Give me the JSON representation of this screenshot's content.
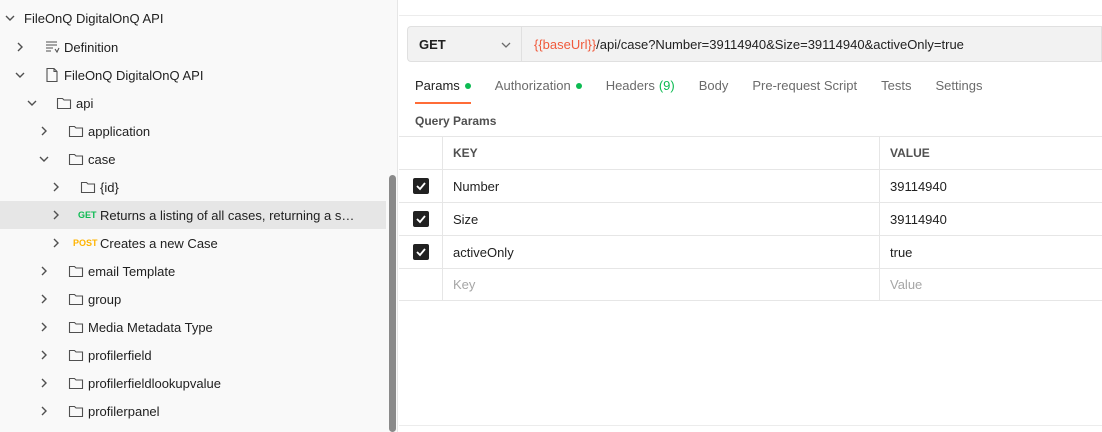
{
  "sidebar": {
    "items": [
      {
        "label": "FileOnQ DigitalOnQ API",
        "type": "collection",
        "expanded": true
      },
      {
        "label": "Definition",
        "type": "definition",
        "expanded": false
      },
      {
        "label": "FileOnQ DigitalOnQ API",
        "type": "document",
        "expanded": true
      },
      {
        "label": "api",
        "type": "folder",
        "expanded": true
      },
      {
        "label": "application",
        "type": "folder",
        "expanded": false
      },
      {
        "label": "case",
        "type": "folder",
        "expanded": true
      },
      {
        "label": "{id}",
        "type": "folder",
        "expanded": false
      },
      {
        "label": "Returns a listing of all cases, returning a sp...",
        "type": "request",
        "method": "GET",
        "selected": true
      },
      {
        "label": "Creates a new Case",
        "type": "request",
        "method": "POST"
      },
      {
        "label": "email Template",
        "type": "folder",
        "expanded": false
      },
      {
        "label": "group",
        "type": "folder",
        "expanded": false
      },
      {
        "label": "Media Metadata Type",
        "type": "folder",
        "expanded": false
      },
      {
        "label": "profilerfield",
        "type": "folder",
        "expanded": false
      },
      {
        "label": "profilerfieldlookupvalue",
        "type": "folder",
        "expanded": false
      },
      {
        "label": "profilerpanel",
        "type": "folder",
        "expanded": false
      }
    ]
  },
  "request": {
    "method": "GET",
    "url_variable": "{{baseUrl}}",
    "url_path": "/api/case?Number=39114940&Size=39114940&activeOnly=true"
  },
  "tabs": [
    {
      "label": "Params",
      "active": true,
      "dot": true
    },
    {
      "label": "Authorization",
      "dot": true
    },
    {
      "label": "Headers",
      "count": "(9)"
    },
    {
      "label": "Body"
    },
    {
      "label": "Pre-request Script"
    },
    {
      "label": "Tests"
    },
    {
      "label": "Settings"
    }
  ],
  "query_params": {
    "title": "Query Params",
    "header_key": "KEY",
    "header_value": "VALUE",
    "rows": [
      {
        "key": "Number",
        "value": "39114940",
        "checked": true
      },
      {
        "key": "Size",
        "value": "39114940",
        "checked": true
      },
      {
        "key": "activeOnly",
        "value": "true",
        "checked": true
      }
    ],
    "placeholder_key": "Key",
    "placeholder_value": "Value"
  },
  "colors": {
    "accent": "#ff6c37",
    "get": "#0cbb52",
    "post": "#ffb400",
    "variable": "#f05a3c"
  }
}
